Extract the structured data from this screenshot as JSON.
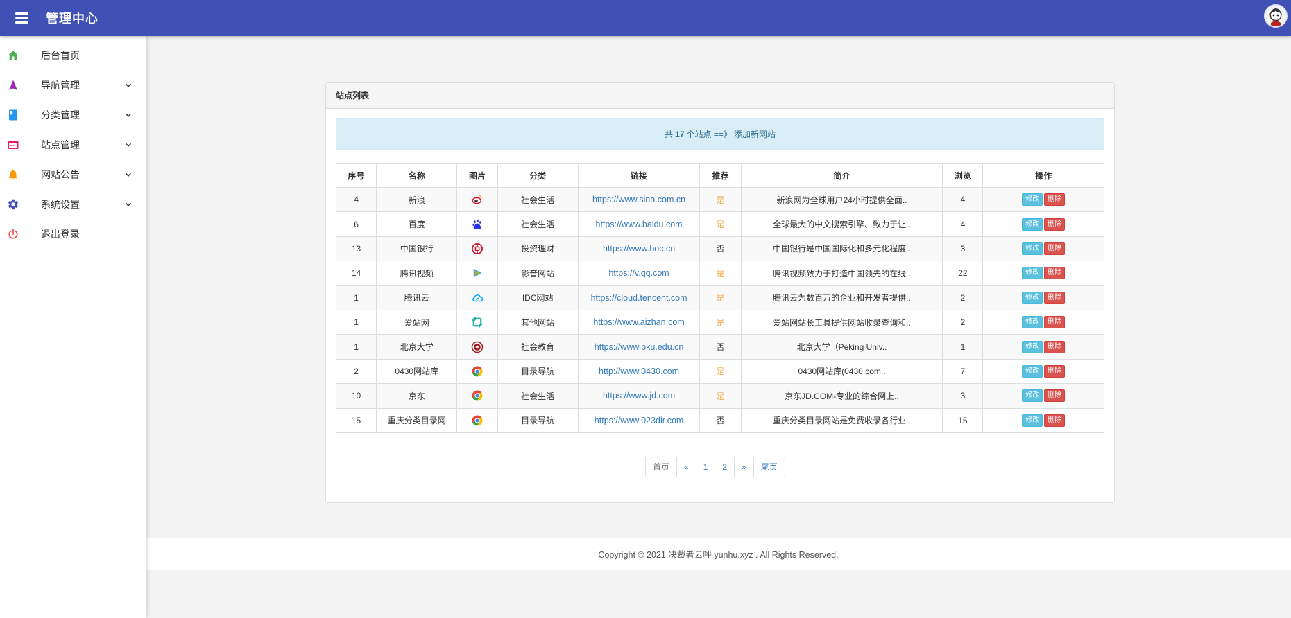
{
  "header": {
    "title": "管理中心",
    "brand_color": "#3f51b5"
  },
  "sidebar": {
    "items": [
      {
        "label": "后台首页",
        "icon": "home-icon",
        "color": "#4caf50",
        "has_submenu": false
      },
      {
        "label": "导航管理",
        "icon": "navigation-arrow-icon",
        "color": "#9c27b0",
        "has_submenu": true
      },
      {
        "label": "分类管理",
        "icon": "book-icon",
        "color": "#2196f3",
        "has_submenu": true
      },
      {
        "label": "站点管理",
        "icon": "web-icon",
        "color": "#e91e63",
        "has_submenu": true
      },
      {
        "label": "网站公告",
        "icon": "bell-icon",
        "color": "#ff9800",
        "has_submenu": true
      },
      {
        "label": "系统设置",
        "icon": "gear-icon",
        "color": "#3f51b5",
        "has_submenu": true
      },
      {
        "label": "退出登录",
        "icon": "power-icon",
        "color": "#f44336",
        "has_submenu": false
      }
    ]
  },
  "card": {
    "title": "站点列表",
    "info": {
      "prefix": "共",
      "count": "17",
      "suffix": "个站点 ==》",
      "link": "添加新网站"
    }
  },
  "table": {
    "headers": [
      "序号",
      "名称",
      "图片",
      "分类",
      "链接",
      "推荐",
      "简介",
      "浏览",
      "操作"
    ],
    "edit_label": "修改",
    "delete_label": "删除",
    "rows": [
      {
        "id": "4",
        "name": "新浪",
        "icon": "weibo-icon",
        "category": "社会生活",
        "link": "https://www.sina.com.cn",
        "recommend": "是",
        "desc": "新浪网为全球用户24小时提供全面..",
        "views": "4"
      },
      {
        "id": "6",
        "name": "百度",
        "icon": "baidu-paw-icon",
        "category": "社会生活",
        "link": "https://www.baidu.com",
        "recommend": "是",
        "desc": "全球最大的中文搜索引擎、致力于让..",
        "views": "4"
      },
      {
        "id": "13",
        "name": "中国银行",
        "icon": "boc-icon",
        "category": "投资理财",
        "link": "https://www.boc.cn",
        "recommend": "否",
        "desc": "中国银行是中国国际化和多元化程度..",
        "views": "3"
      },
      {
        "id": "14",
        "name": "腾讯视频",
        "icon": "play-icon",
        "category": "影音网站",
        "link": "https://v.qq.com",
        "recommend": "是",
        "desc": "腾讯视频致力于打造中国领先的在线..",
        "views": "22"
      },
      {
        "id": "1",
        "name": "腾讯云",
        "icon": "cloud-icon",
        "category": "IDC网站",
        "link": "https://cloud.tencent.com",
        "recommend": "是",
        "desc": "腾讯云为数百万的企业和开发者提供..",
        "views": "2"
      },
      {
        "id": "1",
        "name": "爱站网",
        "icon": "aizhan-icon",
        "category": "其他网站",
        "link": "https://www.aizhan.com",
        "recommend": "是",
        "desc": "爱站网站长工具提供网站收录查询和..",
        "views": "2"
      },
      {
        "id": "1",
        "name": "北京大学",
        "icon": "pku-seal-icon",
        "category": "社会教育",
        "link": "https://www.pku.edu.cn",
        "recommend": "否",
        "desc": "北京大学（Peking Univ..",
        "views": "1"
      },
      {
        "id": "2",
        "name": "0430网站库",
        "icon": "chrome-icon",
        "category": "目录导航",
        "link": "http://www.0430.com",
        "recommend": "是",
        "desc": "0430网站库(0430.com..",
        "views": "7"
      },
      {
        "id": "10",
        "name": "京东",
        "icon": "chrome-icon",
        "category": "社会生活",
        "link": "https://www.jd.com",
        "recommend": "是",
        "desc": "京东JD.COM-专业的综合网上..",
        "views": "3"
      },
      {
        "id": "15",
        "name": "重庆分类目录网",
        "icon": "chrome-icon",
        "category": "目录导航",
        "link": "https://www.023dir.com",
        "recommend": "否",
        "desc": "重庆分类目录网站是免费收录各行业..",
        "views": "15"
      }
    ]
  },
  "pagination": [
    "首页",
    "«",
    "1",
    "2",
    "»",
    "尾页"
  ],
  "footer": {
    "text": "Copyright © 2021 决裁者云呼 yunhu.xyz . All Rights Reserved."
  }
}
